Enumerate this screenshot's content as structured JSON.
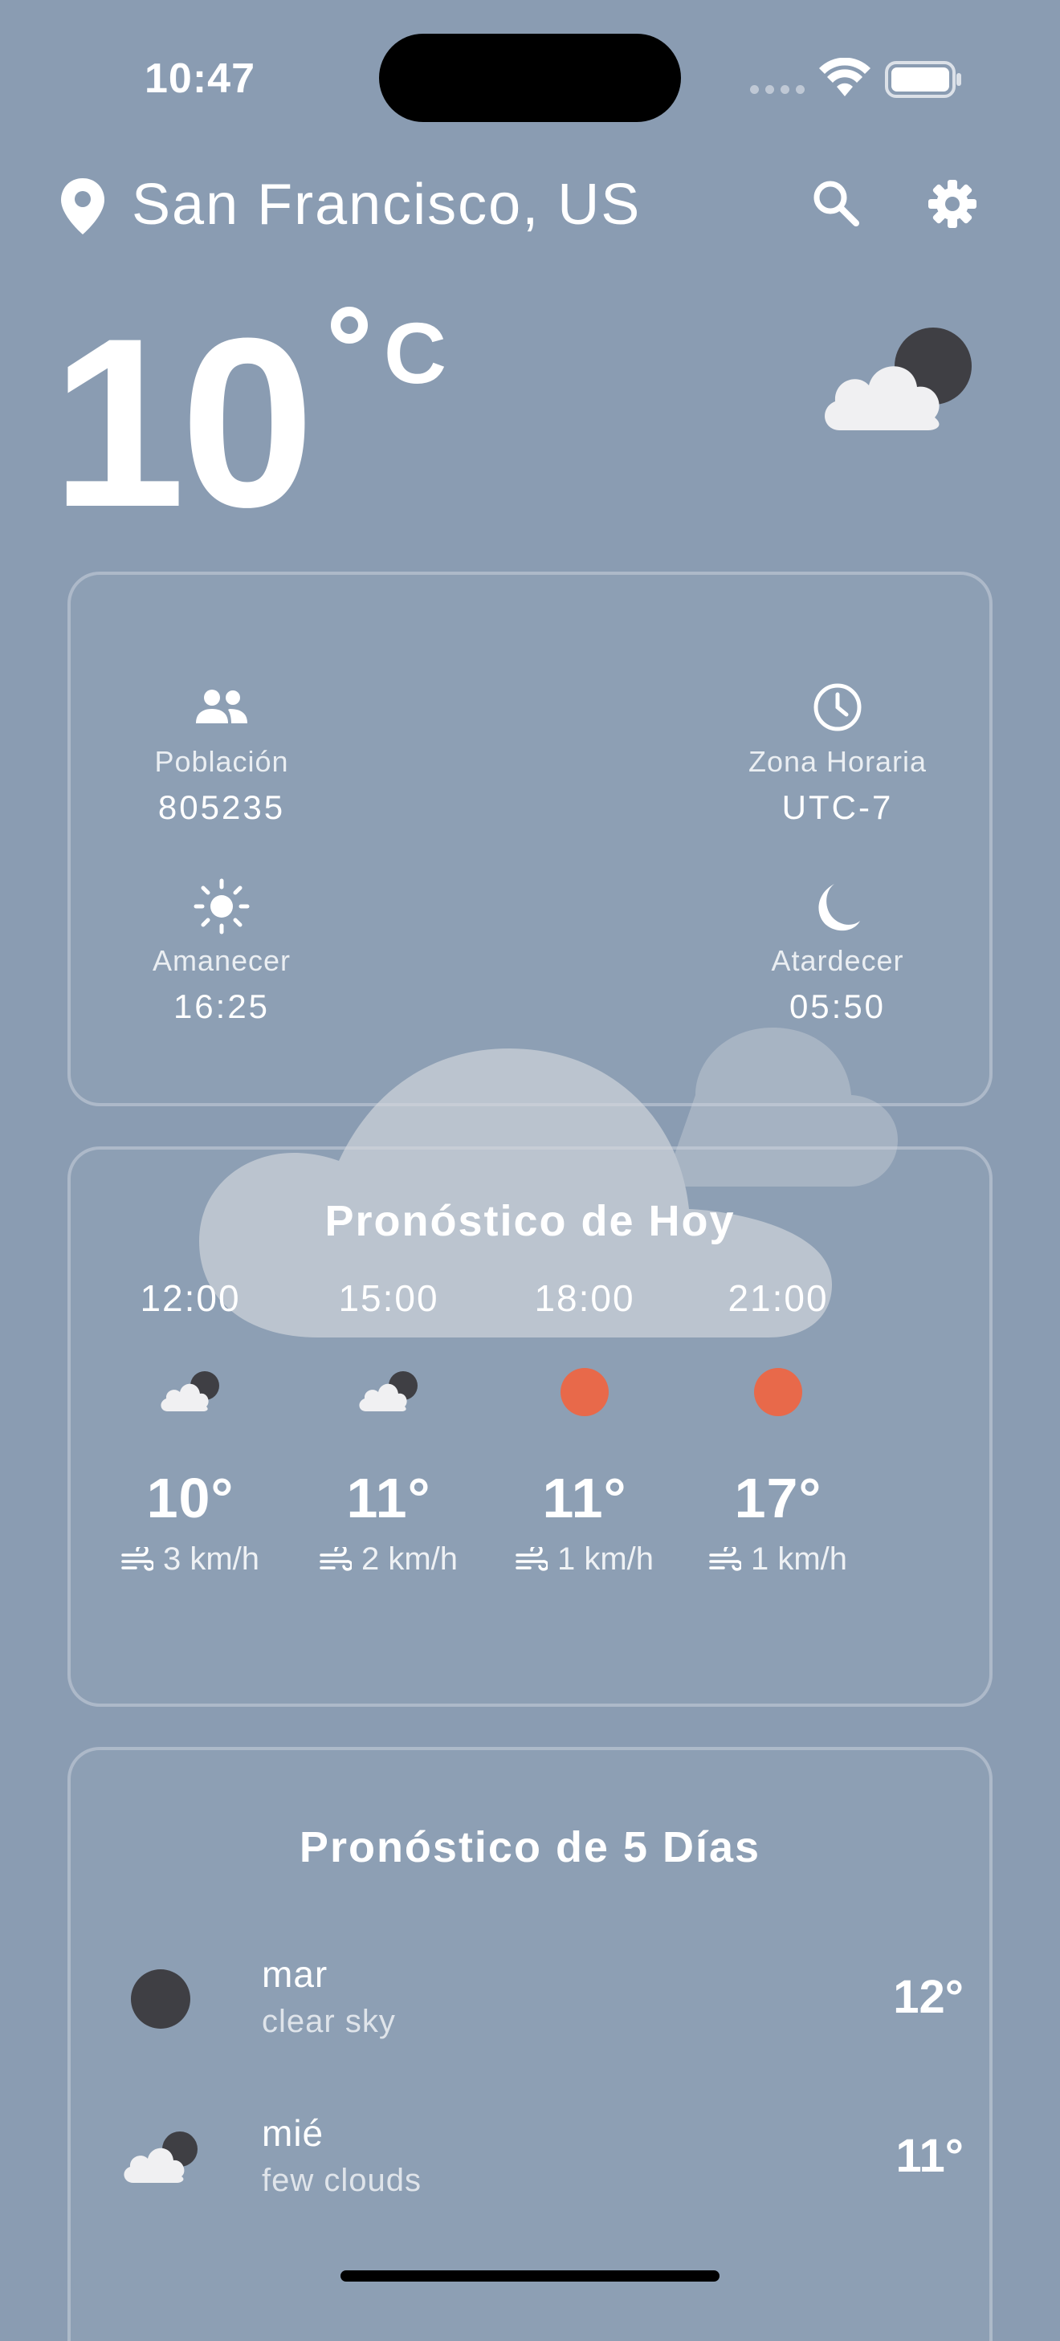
{
  "status_bar": {
    "time": "10:47"
  },
  "header": {
    "city": "San Francisco, US"
  },
  "current": {
    "temp": "10",
    "unit": "C",
    "icon": "cloud-moon-icon"
  },
  "info": {
    "population_label": "Población",
    "population": "805235",
    "timezone_label": "Zona Horaria",
    "timezone": "UTC-7",
    "sunrise_label": "Amanecer",
    "sunrise": "16:25",
    "sunset_label": "Atardecer",
    "sunset": "05:50"
  },
  "today": {
    "title": "Pronóstico de Hoy",
    "hours": [
      {
        "time": "12:00",
        "icon": "cloud-moon-icon",
        "temp": "10°",
        "wind": "3 km/h"
      },
      {
        "time": "15:00",
        "icon": "cloud-moon-icon",
        "temp": "11°",
        "wind": "2 km/h"
      },
      {
        "time": "18:00",
        "icon": "sun-dot-icon",
        "temp": "11°",
        "wind": "1 km/h"
      },
      {
        "time": "21:00",
        "icon": "sun-dot-icon",
        "temp": "17°",
        "wind": "1 km/h"
      }
    ]
  },
  "days": {
    "title": "Pronóstico de 5 Días",
    "items": [
      {
        "day": "mar",
        "desc": "clear sky",
        "temp": "12°",
        "icon": "moon-dot-icon"
      },
      {
        "day": "mié",
        "desc": "few clouds",
        "temp": "11°",
        "icon": "cloud-moon-icon"
      }
    ]
  },
  "colors": {
    "background": "#8a9cb2",
    "sun": "#e8694a",
    "moon": "#3f3f44",
    "cloud": "#f0f0f2"
  }
}
